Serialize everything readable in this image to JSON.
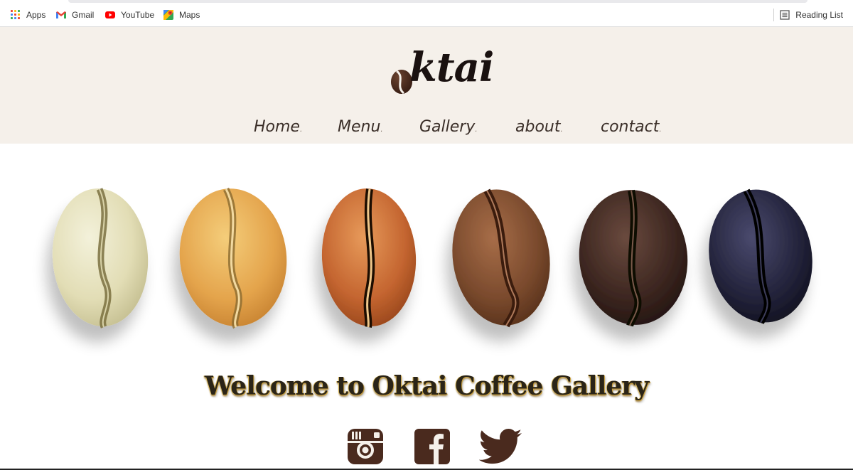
{
  "bookmarks": {
    "items": [
      {
        "label": "Apps",
        "icon": "apps-grid-icon"
      },
      {
        "label": "Gmail",
        "icon": "gmail-icon"
      },
      {
        "label": "YouTube",
        "icon": "youtube-icon"
      },
      {
        "label": "Maps",
        "icon": "maps-icon"
      }
    ],
    "reading_list": {
      "label": "Reading List",
      "icon": "reading-list-icon"
    }
  },
  "site": {
    "logo": "ktai",
    "nav": [
      {
        "label": "Home"
      },
      {
        "label": "Menu"
      },
      {
        "label": "Gallery"
      },
      {
        "label": "about"
      },
      {
        "label": "contact"
      }
    ],
    "welcome": "Welcome to Oktai Coffee Gallery",
    "social": [
      {
        "icon": "instagram-icon"
      },
      {
        "icon": "facebook-icon"
      },
      {
        "icon": "twitter-icon"
      }
    ]
  },
  "colors": {
    "header_bg": "#f5f0ea",
    "brown": "#4a2a1e",
    "nav_text": "#3a2e28",
    "bean_roasts": [
      "#e6e2bf",
      "#e5a94c",
      "#c66a32",
      "#7b4a2d",
      "#3b2520",
      "#22223a"
    ]
  }
}
